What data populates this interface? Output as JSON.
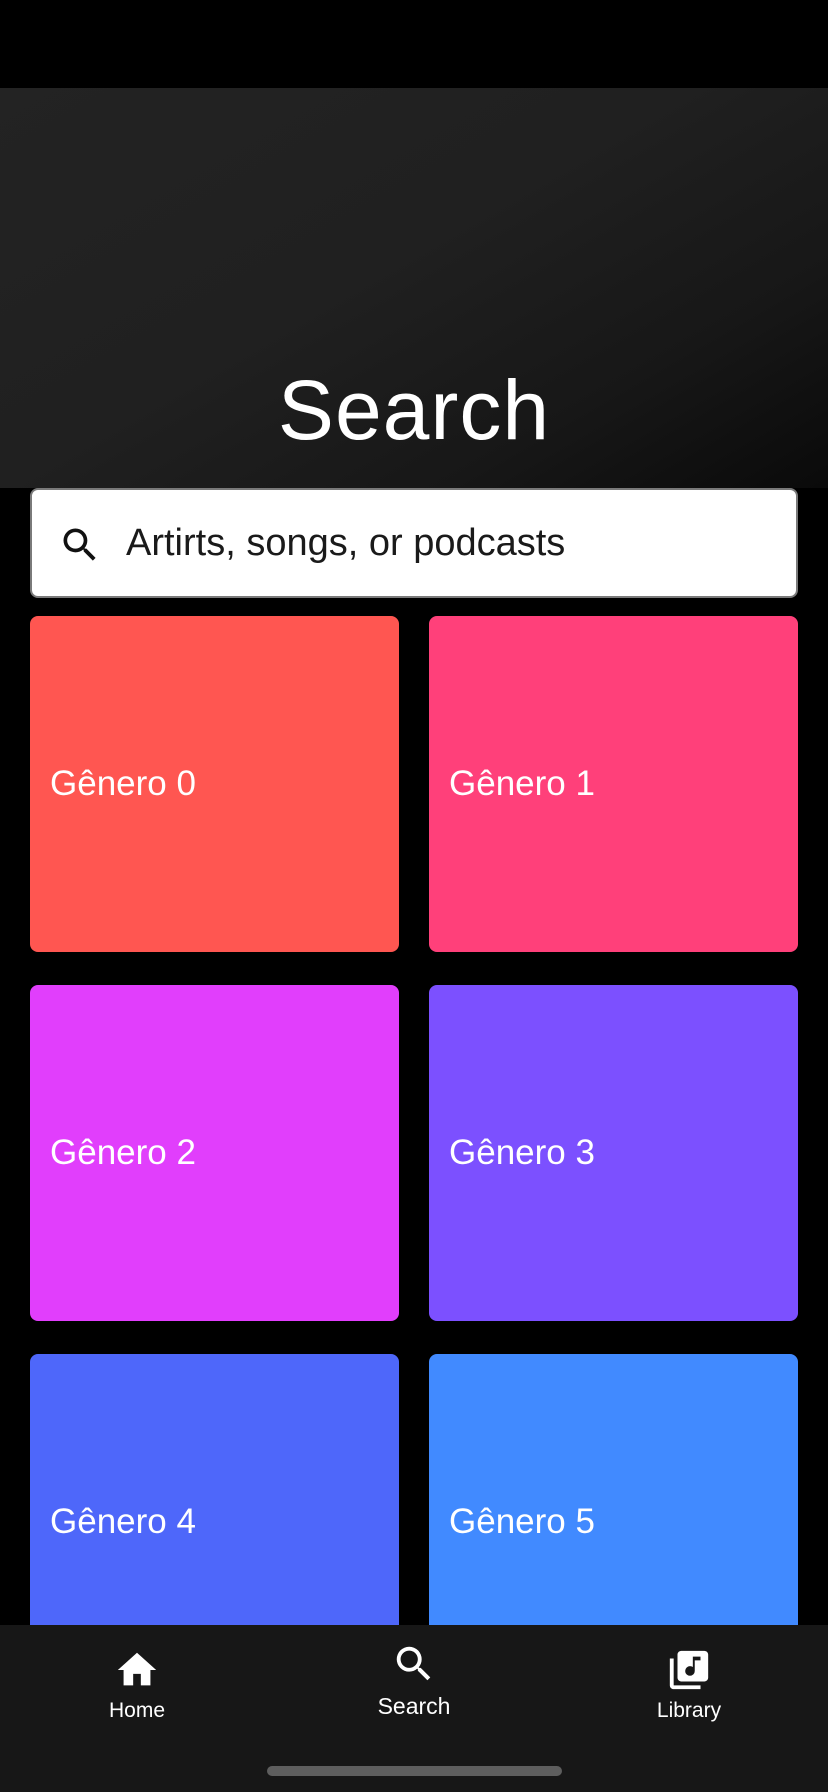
{
  "header": {
    "title": "Search"
  },
  "search": {
    "placeholder": "Artirts, songs, or podcasts",
    "icon": "search-icon"
  },
  "genres": [
    {
      "label": "Gênero 0",
      "color": "#FF5651"
    },
    {
      "label": "Gênero 1",
      "color": "#FF407A"
    },
    {
      "label": "Gênero 2",
      "color": "#E13EFC"
    },
    {
      "label": "Gênero 3",
      "color": "#7C50FF"
    },
    {
      "label": "Gênero 4",
      "color": "#4E67FA"
    },
    {
      "label": "Gênero 5",
      "color": "#418AFF"
    }
  ],
  "bottom_nav": {
    "items": [
      {
        "label": "Home",
        "icon": "home-icon",
        "active": false
      },
      {
        "label": "Search",
        "icon": "search-icon",
        "active": true
      },
      {
        "label": "Library",
        "icon": "library-icon",
        "active": false
      }
    ]
  },
  "colors": {
    "background": "#000000",
    "nav_background": "#171717",
    "text": "#FFFFFF"
  }
}
